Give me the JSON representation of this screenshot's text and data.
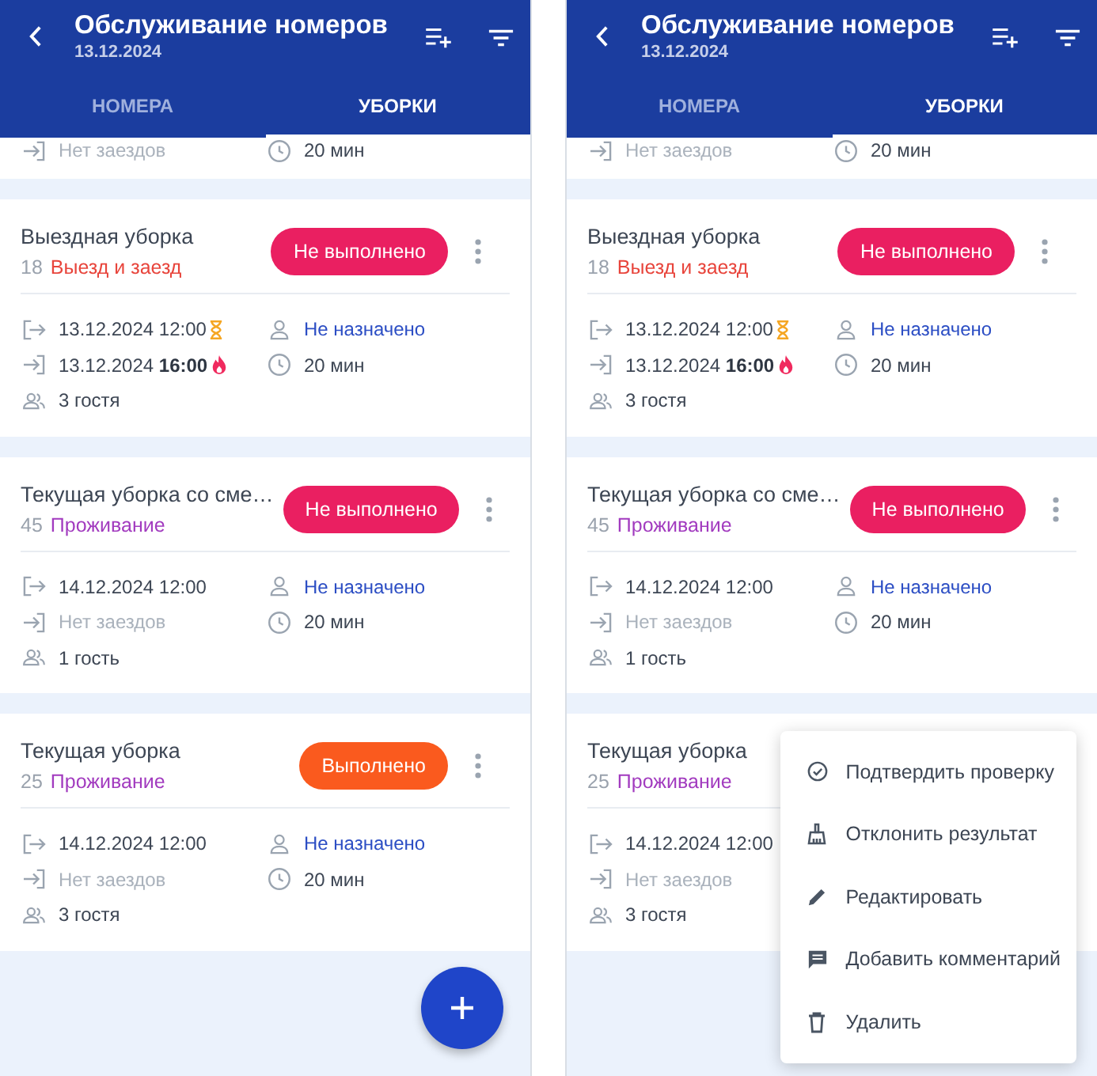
{
  "screens": [
    {
      "header": {
        "title": "Обслуживание номеров",
        "date": "13.12.2024"
      },
      "tabs": [
        {
          "label": "НОМЕРА",
          "selected": false
        },
        {
          "label": "УБОРКИ",
          "selected": true
        }
      ],
      "cards": [
        {
          "left": [
            {
              "kind": "arrival",
              "text": "Нет заездов",
              "muted": true
            }
          ],
          "right": [
            {
              "kind": "duration",
              "text": "20 мин"
            }
          ]
        },
        {
          "title": "Выездная уборка",
          "number": "18",
          "stay": {
            "label": "Выезд и заезд",
            "color": "#e8453c"
          },
          "status": {
            "label": "Не выполнено",
            "kind": "pending"
          },
          "left": [
            {
              "kind": "departure",
              "text": "13.12.2024 12:00",
              "flag": {
                "kind": "waiting"
              },
              "muted": false
            },
            {
              "kind": "arrival",
              "text": "13.12.2024 **16:00**",
              "flag": {
                "kind": "urgent"
              },
              "muted": false
            },
            {
              "kind": "guests",
              "text": "3 гостя",
              "muted": false
            }
          ],
          "right": [
            {
              "kind": "assignee",
              "text": "Не назначено"
            },
            {
              "kind": "duration",
              "text": "20 мин"
            }
          ]
        },
        {
          "title": "Текущая уборка со сме…",
          "number": "45",
          "stay": {
            "label": "Проживание",
            "color": "#a23bbf"
          },
          "status": {
            "label": "Не выполнено",
            "kind": "pending"
          },
          "left": [
            {
              "kind": "departure",
              "text": "14.12.2024 12:00",
              "muted": false
            },
            {
              "kind": "arrival",
              "text": "Нет заездов",
              "muted": true
            },
            {
              "kind": "guests",
              "text": "1 гость",
              "muted": false
            }
          ],
          "right": [
            {
              "kind": "assignee",
              "text": "Не назначено"
            },
            {
              "kind": "duration",
              "text": "20 мин"
            }
          ]
        },
        {
          "title": "Текущая уборка",
          "number": "25",
          "stay": {
            "label": "Проживание",
            "color": "#a23bbf"
          },
          "status": {
            "label": "Выполнено",
            "kind": "done"
          },
          "left": [
            {
              "kind": "departure",
              "text": "14.12.2024 12:00",
              "muted": false
            },
            {
              "kind": "arrival",
              "text": "Нет заездов",
              "muted": true
            },
            {
              "kind": "guests",
              "text": "3 гостя",
              "muted": false
            }
          ],
          "right": [
            {
              "kind": "assignee",
              "text": "Не назначено"
            },
            {
              "kind": "duration",
              "text": "20 мин"
            }
          ]
        }
      ]
    },
    {
      "header": {
        "title": "Обслуживание номеров",
        "date": "13.12.2024"
      },
      "tabs": [
        {
          "label": "НОМЕРА",
          "selected": false
        },
        {
          "label": "УБОРКИ",
          "selected": true
        }
      ],
      "cards": [
        {
          "left": [
            {
              "kind": "arrival",
              "text": "Нет заездов",
              "muted": true
            }
          ],
          "right": [
            {
              "kind": "duration",
              "text": "20 мин"
            }
          ]
        },
        {
          "title": "Выездная уборка",
          "number": "18",
          "stay": {
            "label": "Выезд и заезд",
            "color": "#e8453c"
          },
          "status": {
            "label": "Не выполнено",
            "kind": "pending"
          },
          "left": [
            {
              "kind": "departure",
              "text": "13.12.2024 12:00",
              "flag": {
                "kind": "waiting"
              },
              "muted": false
            },
            {
              "kind": "arrival",
              "text": "13.12.2024 **16:00**",
              "flag": {
                "kind": "urgent"
              },
              "muted": false
            },
            {
              "kind": "guests",
              "text": "3 гостя",
              "muted": false
            }
          ],
          "right": [
            {
              "kind": "assignee",
              "text": "Не назначено"
            },
            {
              "kind": "duration",
              "text": "20 мин"
            }
          ]
        },
        {
          "title": "Текущая уборка со сме…",
          "number": "45",
          "stay": {
            "label": "Проживание",
            "color": "#a23bbf"
          },
          "status": {
            "label": "Не выполнено",
            "kind": "pending"
          },
          "left": [
            {
              "kind": "departure",
              "text": "14.12.2024 12:00",
              "muted": false
            },
            {
              "kind": "arrival",
              "text": "Нет заездов",
              "muted": true
            },
            {
              "kind": "guests",
              "text": "1 гость",
              "muted": false
            }
          ],
          "right": [
            {
              "kind": "assignee",
              "text": "Не назначено"
            },
            {
              "kind": "duration",
              "text": "20 мин"
            }
          ]
        },
        {
          "title": "Текущая уборка",
          "number": "25",
          "stay": {
            "label": "Проживание",
            "color": "#a23bbf"
          },
          "left": [
            {
              "kind": "departure",
              "text": "14.12.2024 12:00",
              "muted": false
            },
            {
              "kind": "arrival",
              "text": "Нет заездов",
              "muted": true
            },
            {
              "kind": "guests",
              "text": "3 гостя",
              "muted": false
            }
          ]
        }
      ],
      "menu": {
        "items": [
          {
            "kind": "confirm",
            "label": "Подтвердить проверку"
          },
          {
            "kind": "reject",
            "label": "Отклонить результат"
          },
          {
            "kind": "edit",
            "label": "Редактировать"
          },
          {
            "kind": "comment",
            "label": "Добавить комментарий"
          },
          {
            "kind": "delete",
            "label": "Удалить"
          }
        ]
      }
    }
  ]
}
